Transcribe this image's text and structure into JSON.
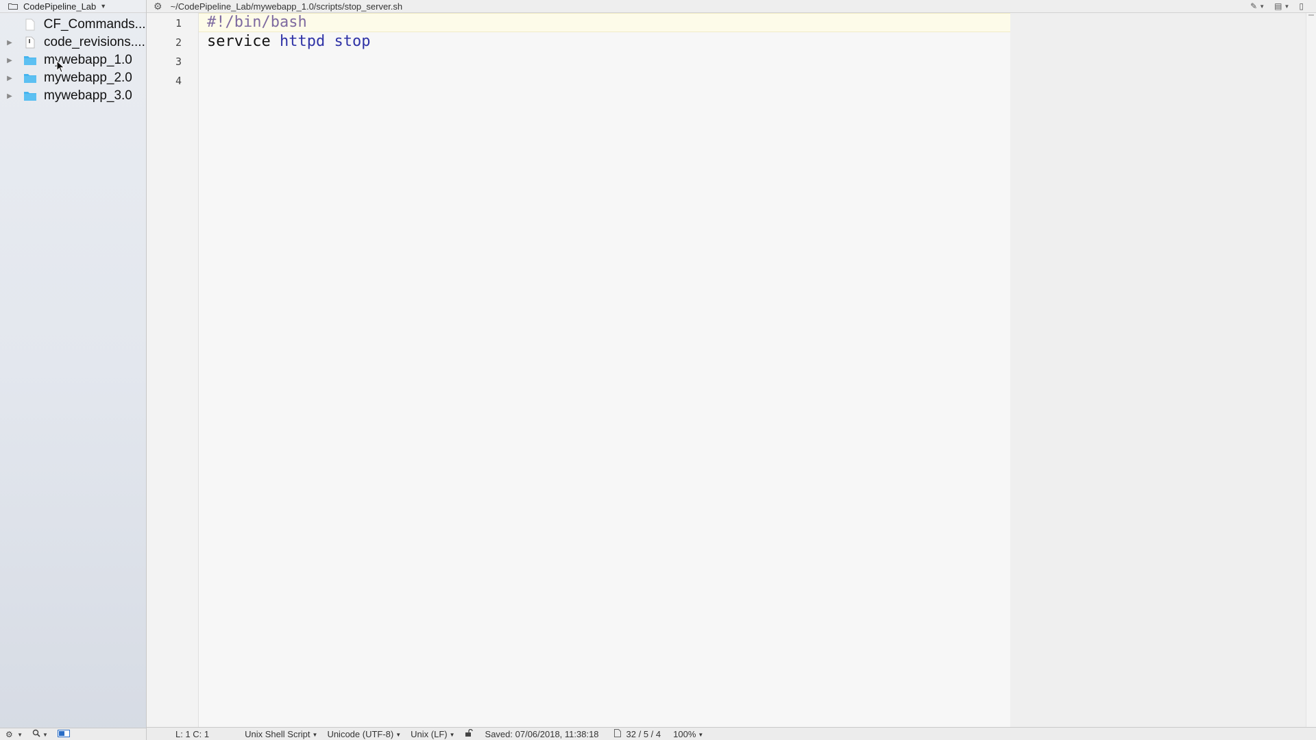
{
  "sidebar": {
    "project_name": "CodePipeline_Lab",
    "items": [
      {
        "label": "CF_Commands....",
        "type": "file",
        "expandable": false
      },
      {
        "label": "code_revisions....",
        "type": "file-lines",
        "expandable": true
      },
      {
        "label": "mywebapp_1.0",
        "type": "folder",
        "expandable": true
      },
      {
        "label": "mywebapp_2.0",
        "type": "folder",
        "expandable": true
      },
      {
        "label": "mywebapp_3.0",
        "type": "folder",
        "expandable": true
      }
    ],
    "footer": {
      "settings": "⚙",
      "search": "🔍",
      "layout": "▭"
    }
  },
  "path": "~/CodePipeline_Lab/mywebapp_1.0/scripts/stop_server.sh",
  "editor": {
    "line_numbers": [
      "1",
      "2",
      "3",
      "4"
    ],
    "lines": [
      {
        "tokens": [
          {
            "t": "#!/bin/bash",
            "c": "comment"
          }
        ]
      },
      {
        "tokens": [
          {
            "t": "service ",
            "c": "plain"
          },
          {
            "t": "httpd",
            "c": "kw"
          },
          {
            "t": " ",
            "c": "plain"
          },
          {
            "t": "stop",
            "c": "kw"
          }
        ]
      },
      {
        "tokens": []
      },
      {
        "tokens": []
      }
    ]
  },
  "status": {
    "position": "L: 1 C: 1",
    "language": "Unix Shell Script",
    "encoding": "Unicode (UTF-8)",
    "line_endings": "Unix (LF)",
    "saved": "Saved: 07/06/2018, 11:38:18",
    "counts": "32 / 5 / 4",
    "zoom": "100%"
  },
  "colors": {
    "comment": "#7e6aa0",
    "keyword": "#2f33a6",
    "current_line": "#fdfbe9",
    "folder": "#45b4ee"
  }
}
